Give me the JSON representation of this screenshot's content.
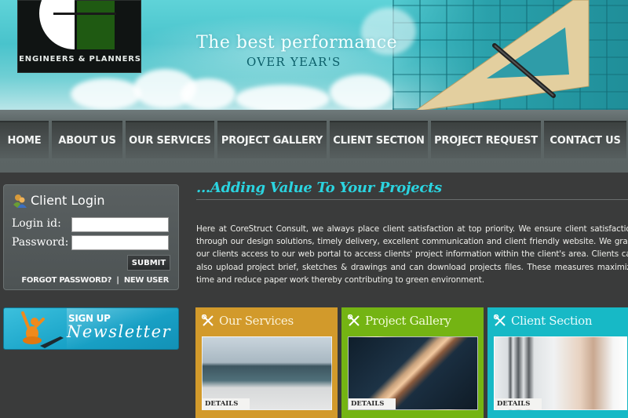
{
  "header": {
    "logo_text": "ENGINEERS & PLANNERS",
    "tagline": "The best performance",
    "tagline_sub": "OVER YEAR'S"
  },
  "nav": {
    "items": [
      {
        "label": "HOME"
      },
      {
        "label": "ABOUT US"
      },
      {
        "label": "OUR SERVICES"
      },
      {
        "label": "PROJECT GALLERY"
      },
      {
        "label": "CLIENT SECTION"
      },
      {
        "label": "PROJECT REQUEST"
      },
      {
        "label": "CONTACT US"
      }
    ]
  },
  "login": {
    "title": "Client Login",
    "icon": "users-icon",
    "login_id_label": "Login id:",
    "password_label": "Password:",
    "login_id_value": "",
    "password_value": "",
    "submit_label": "SUBMIT",
    "forgot_label": "FORGOT PASSWORD?",
    "separator": "|",
    "new_user_label": "NEW USER"
  },
  "newsletter": {
    "sign_up": "SIGN UP",
    "label": "Newsletter"
  },
  "main": {
    "heading": "...Adding Value To Your Projects",
    "intro": "Here at CoreStruct Consult, we always place client satisfaction at top priority. We ensure client satisfaction through our design solutions, timely delivery, excellent communication and client friendly website. We grant our clients access to our web portal to access clients' project information within the client's area. Clients can also upload project brief, sketches & drawings and can download projects files. These measures maximize time and reduce paper work thereby contributing to green environment."
  },
  "cards": [
    {
      "title": "Our Services",
      "details": "DETAILS >>",
      "color": "#d29a2b",
      "icon": "tools-icon"
    },
    {
      "title": "Project Gallery",
      "details": "DETAILS >>",
      "color": "#74b413",
      "icon": "tools-icon"
    },
    {
      "title": "Client Section",
      "details": "DETAILS >>",
      "color": "#17b9c6",
      "icon": "tools-icon"
    }
  ]
}
